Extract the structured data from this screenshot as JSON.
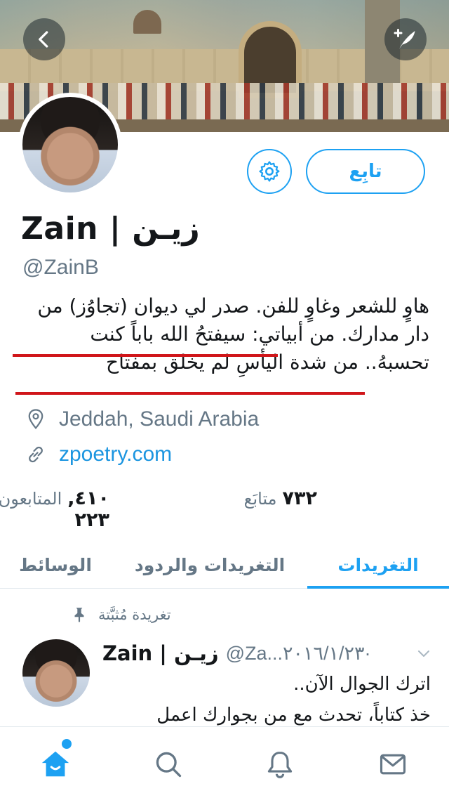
{
  "header": {
    "back_icon": "chevron-left-icon",
    "compose_icon": "compose-quill-icon"
  },
  "profile": {
    "name": "Zain | زيـن",
    "handle": "@ZainB",
    "follow_label": "تابِع",
    "bio_lines": [
      "هاوٍ للشعر وغاوٍ للفن. صدر لي ديوان (تجاوُز) من",
      "دار مدارك. من أبياتي: سيفتحُ الله باباً كنت",
      "تحسبهُ.. من شدة اليأسِ لم يخلق بمفتاح"
    ],
    "location": "Jeddah, Saudi Arabia",
    "website": "zpoetry.com",
    "following_count": "٧٣٢",
    "following_label": "متابَع",
    "followers_count": "٤١٠, ٢٢٣",
    "followers_label": "المتابعون",
    "accent_color": "#1da1f2",
    "underline_color": "#d0161a"
  },
  "tabs": [
    {
      "label": "التغريدات",
      "active": true
    },
    {
      "label": "التغريدات والردود",
      "active": false
    },
    {
      "label": "الوسائط",
      "active": false
    }
  ],
  "tweet": {
    "pinned_label": "تغريدة مُثبَّتة",
    "name": "Zain | زيـن",
    "handle_date": "@Za...٢٠١٦/١/٢٣·",
    "lines": [
      "اترك الجوال الآن..",
      "خذ كتاباً، تحدث مع من بجوارك اعمل"
    ]
  },
  "bottom_nav": [
    "home-icon",
    "search-icon",
    "notifications-icon",
    "messages-icon"
  ]
}
